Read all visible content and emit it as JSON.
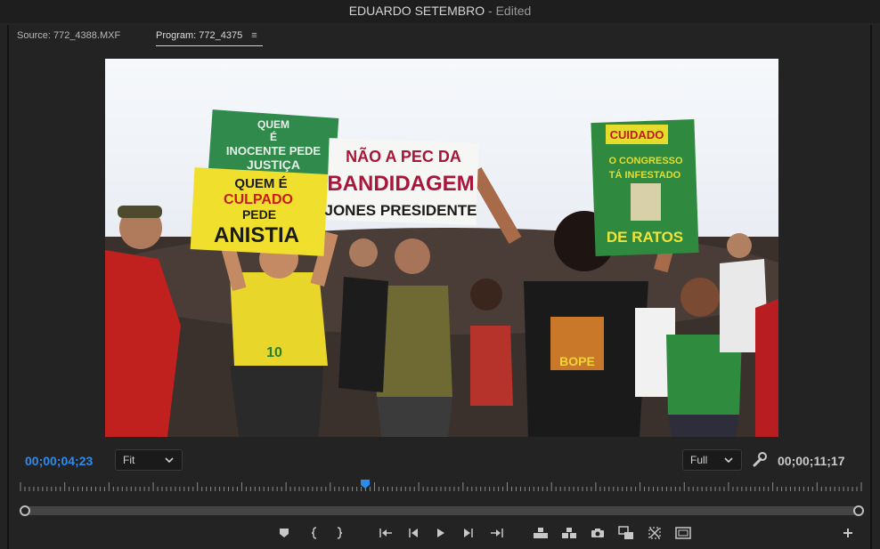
{
  "window": {
    "title": "EDUARDO SETEMBRO",
    "status": " - Edited"
  },
  "tabs": {
    "source": "Source: 772_4388.MXF",
    "program": "Program: 772_4375",
    "menu": "≡"
  },
  "video": {
    "signs": {
      "green_left": [
        "QUEM",
        "É",
        "INOCENTE PEDE",
        "JUSTIÇA"
      ],
      "yellow": [
        "QUEM É",
        "CULPADO",
        "PEDE",
        "ANISTIA"
      ],
      "white": [
        "NÃO A PEC DA",
        "BANDIDAGEM",
        "JONES PRESIDENTE"
      ],
      "green_right": [
        "CUIDADO",
        "O CONGRESSO",
        "TÁ INFESTADO",
        "DE RATOS"
      ],
      "shirt_left": "10",
      "shirt_right": "BOPE"
    }
  },
  "controls": {
    "current_timecode": "00;00;04;23",
    "duration_timecode": "00;00;11;17",
    "zoom_dropdown": "Fit",
    "resolution_dropdown": "Full",
    "playhead_fraction": 0.41
  },
  "colors": {
    "accent": "#2d8ceb",
    "panel": "#232323"
  },
  "icons": [
    "marker-icon",
    "in-point-icon",
    "out-point-icon",
    "go-to-in-icon",
    "step-back-icon",
    "play-icon",
    "step-forward-icon",
    "go-to-out-icon",
    "lift-icon",
    "extract-icon",
    "camera-icon",
    "button-editor-icon",
    "compare-icon",
    "safe-margins-icon",
    "add-icon"
  ]
}
